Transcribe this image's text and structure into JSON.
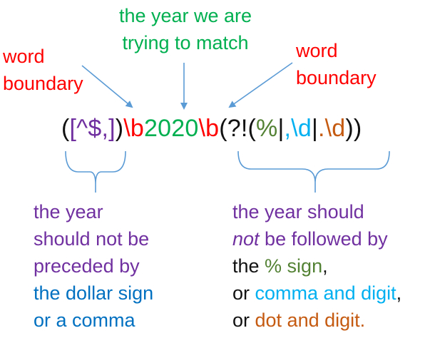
{
  "colors": {
    "red": "#ff0000",
    "green": "#00b050",
    "purple": "#7030a0",
    "blue": "#0070c0",
    "cyan": "#00b0f0",
    "olive": "#548235",
    "orange": "#c55a11",
    "arrow": "#5b9bd5"
  },
  "labels": {
    "year_match": [
      "the year we are",
      "trying to match"
    ],
    "word_boundary_left": [
      "word",
      "boundary"
    ],
    "word_boundary_right": [
      "word",
      "boundary"
    ]
  },
  "regex": {
    "p1": "(",
    "p2": "[^$,]",
    "p3": ")",
    "p4": "\\b",
    "p5": "2020",
    "p6": "\\b",
    "p7": "(?!(",
    "p8": "%",
    "p9": "|",
    "p10": ",\\d",
    "p11": "|",
    "p12": ".\\d",
    "p13": "))"
  },
  "explain_left": {
    "line1": "the year",
    "line2": "should not be",
    "line3": "preceded by",
    "line4": "the dollar sign",
    "line5": "or a comma"
  },
  "explain_right": {
    "line1": "the year should",
    "line2_em": "not",
    "line2_rest": " be followed by",
    "line3_a": "the ",
    "line3_b": "% sign",
    "line3_c": ",",
    "line4_a": "or ",
    "line4_b": "comma and digit",
    "line4_c": ",",
    "line5_a": "or ",
    "line5_b": "dot and digit."
  }
}
